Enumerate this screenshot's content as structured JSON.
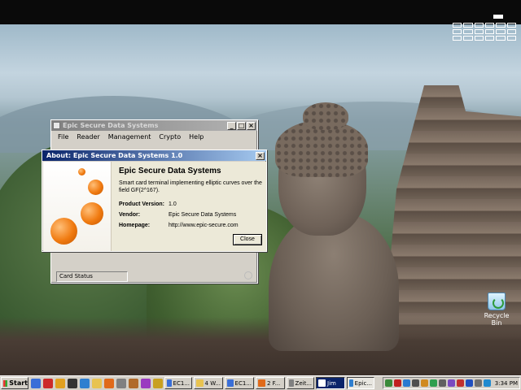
{
  "desktop": {
    "recycle_bin_label": "Recycle Bin"
  },
  "main_window": {
    "title": "Epic Secure Data Systems",
    "menu": [
      "File",
      "Reader",
      "Management",
      "Crypto",
      "Help"
    ],
    "status_text": "Card Status",
    "buttons": {
      "minimize": "_",
      "maximize": "□",
      "close": "×"
    }
  },
  "about_dialog": {
    "title": "About: Epic Secure Data Systems 1.0",
    "close_glyph": "×",
    "heading": "Epic Secure Data Systems",
    "description": "Smart card terminal implementing elliptic curves over the field GF(2^167).",
    "fields": [
      {
        "label": "Product Version:",
        "value": "1.0"
      },
      {
        "label": "Vendor:",
        "value": "Epic Secure Data Systems"
      },
      {
        "label": "Homepage:",
        "value": "http://www.epic-secure.com"
      }
    ],
    "close_button": "Close"
  },
  "taskbar": {
    "start_label": "Start",
    "quick_launch": [
      {
        "icon": "ie-icon",
        "color": "#3a6fd8"
      },
      {
        "icon": "pdf-icon",
        "color": "#cc2a2a"
      },
      {
        "icon": "mail-icon",
        "color": "#e0a020"
      },
      {
        "icon": "terminal-icon",
        "color": "#333333"
      },
      {
        "icon": "shield-icon",
        "color": "#2f7fd0"
      },
      {
        "icon": "folder-icon",
        "color": "#e8c350"
      },
      {
        "icon": "firefox-icon",
        "color": "#e06a1a"
      },
      {
        "icon": "gear-icon",
        "color": "#808080"
      },
      {
        "icon": "tools-icon",
        "color": "#b06a2a"
      },
      {
        "icon": "paint-icon",
        "color": "#9a3ac0"
      },
      {
        "icon": "key-icon",
        "color": "#c8a020"
      }
    ],
    "tasks": [
      {
        "label": "EC1...",
        "icon_color": "#3a6fd8",
        "state": "normal"
      },
      {
        "label": "4 W...",
        "icon_color": "#e8c350",
        "state": "normal"
      },
      {
        "label": "EC1...",
        "icon_color": "#3a6fd8",
        "state": "normal"
      },
      {
        "label": "2 F...",
        "icon_color": "#e06a1a",
        "state": "normal"
      },
      {
        "label": "Zeit...",
        "icon_color": "#808080",
        "state": "normal"
      },
      {
        "label": "Jim",
        "icon_color": "#ffffff",
        "state": "active"
      },
      {
        "label": "Epic...",
        "icon_color": "#2f7fd0",
        "state": "pressed"
      }
    ],
    "tray_icons": [
      {
        "icon": "network-icon",
        "color": "#3a8a3a"
      },
      {
        "icon": "antivirus-icon",
        "color": "#c02020"
      },
      {
        "icon": "chat-icon",
        "color": "#2a7ad0"
      },
      {
        "icon": "volume-icon",
        "color": "#505050"
      },
      {
        "icon": "update-icon",
        "color": "#d08a20"
      },
      {
        "icon": "shield-tray-icon",
        "color": "#2f9f4f"
      },
      {
        "icon": "printer-icon",
        "color": "#606060"
      },
      {
        "icon": "card-reader-icon",
        "color": "#7a4ac0"
      },
      {
        "icon": "security-icon",
        "color": "#c03030"
      },
      {
        "icon": "bluetooth-icon",
        "color": "#2050c0"
      },
      {
        "icon": "power-icon",
        "color": "#707070"
      },
      {
        "icon": "display-icon",
        "color": "#208ad0"
      }
    ],
    "clock": "3:34 PM"
  }
}
